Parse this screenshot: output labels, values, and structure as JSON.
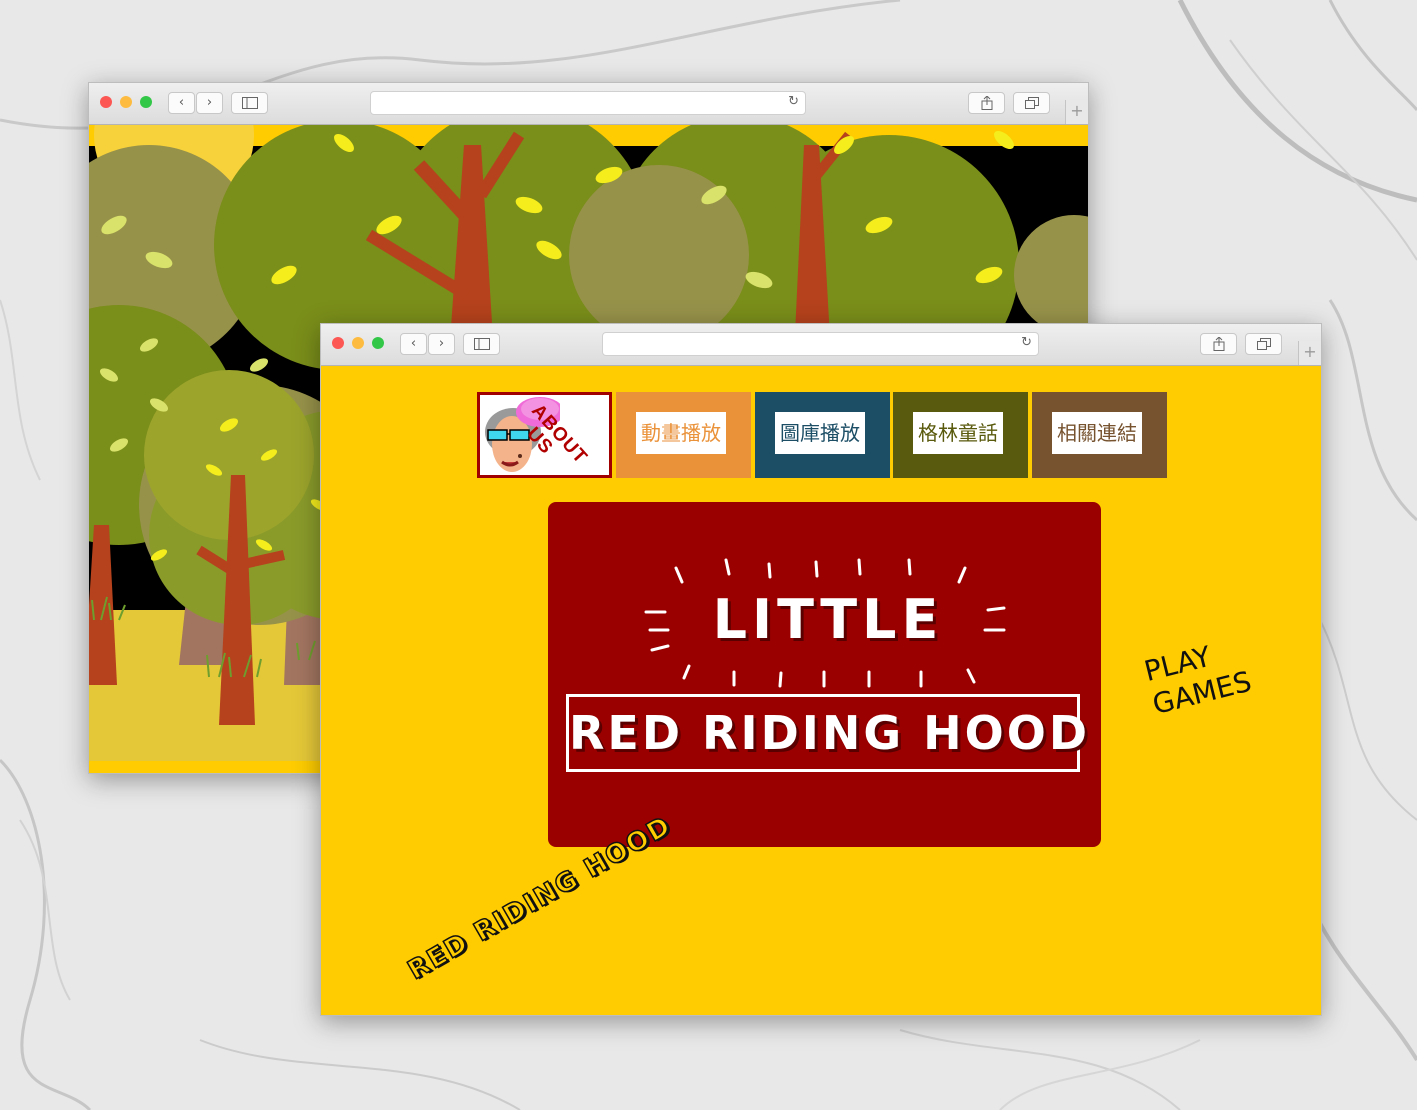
{
  "colors": {
    "page_yellow": "#fecc00",
    "title_card_red": "#9b0000",
    "nav_orange": "#ea923a",
    "nav_teal": "#1c4e66",
    "nav_olive": "#5a5a0e",
    "nav_brown": "#775330",
    "forest_green": "#7a8e1a",
    "tree_trunk": "#b5421c",
    "leaf_yellow": "#f5ee1c"
  },
  "icons": {
    "back": "chevron-left-icon",
    "forward": "chevron-right-icon",
    "sidebar": "sidebar-icon",
    "reload": "reload-icon",
    "share": "share-icon",
    "tabs": "tabs-icon",
    "new_tab": "plus-icon"
  },
  "browser_back": {
    "address": "",
    "new_tab_symbol": "+"
  },
  "browser_front": {
    "address": "",
    "new_tab_symbol": "+"
  },
  "nav": {
    "about": {
      "line1": "ABOUT",
      "line2": "US"
    },
    "items": [
      {
        "label": "動畫播放"
      },
      {
        "label": "圖庫播放"
      },
      {
        "label": "格林童話"
      },
      {
        "label": "相關連結"
      }
    ]
  },
  "hero": {
    "line1": "LITTLE",
    "line2": "RED RIDING HOOD"
  },
  "play_games": {
    "line1": "PLAY",
    "line2": "GAMES"
  },
  "footer_scribble": "RED RIDING HOOD"
}
